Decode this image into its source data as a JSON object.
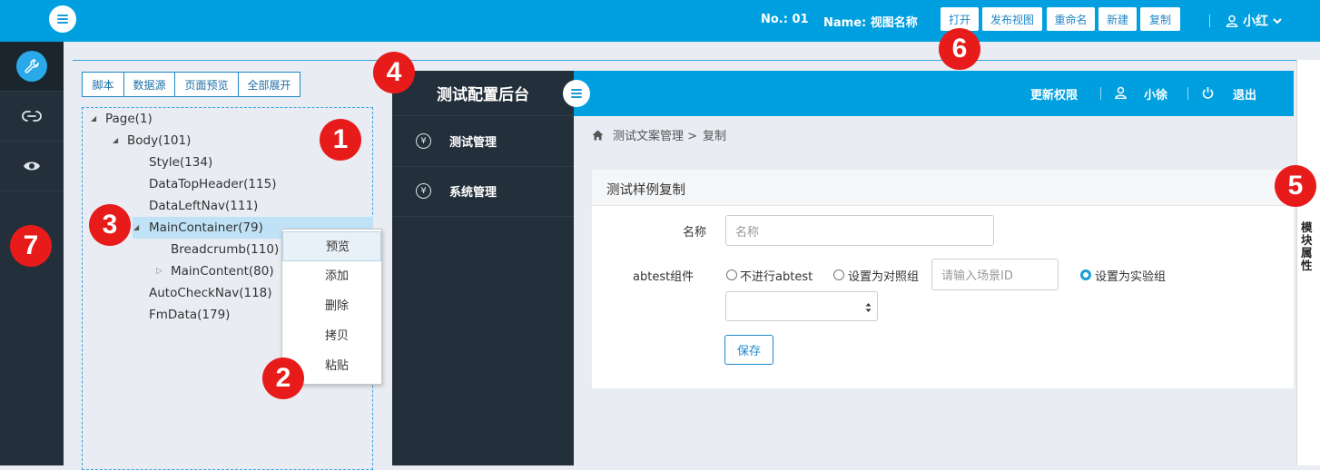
{
  "topbar": {
    "no_label": "No.: 01",
    "name_label": "Name: 视图名称",
    "buttons": [
      "打开",
      "发布视图",
      "重命名",
      "新建",
      "复制"
    ],
    "user": "小红"
  },
  "toolbar": {
    "buttons": [
      "脚本",
      "数据源",
      "页面预览",
      "全部展开"
    ]
  },
  "tree": {
    "nodes": [
      "Page(1)",
      "Body(101)",
      "Style(134)",
      "DataTopHeader(115)",
      "DataLeftNav(111)",
      "MainContainer(79)",
      "Breadcrumb(110)",
      "MainContent(80)",
      "AutoCheckNav(118)",
      "FmData(179)"
    ]
  },
  "context_menu": {
    "items": [
      "预览",
      "添加",
      "删除",
      "拷贝",
      "粘贴"
    ]
  },
  "badges": [
    "1",
    "2",
    "3",
    "4",
    "5",
    "6",
    "7"
  ],
  "preview": {
    "brand": "测试配置后台",
    "header": {
      "update_perm": "更新权限",
      "user": "小徐",
      "logout": "退出"
    },
    "nav": [
      "测试管理",
      "系统管理"
    ],
    "nav_icon_glyph": "¥",
    "breadcrumb": {
      "path": "测试文案管理 >",
      "current": "复制"
    },
    "form": {
      "title": "测试样例复制",
      "name_label": "名称",
      "name_placeholder": "名称",
      "abtest_label": "abtest组件",
      "radio_no": "不进行abtest",
      "radio_control": "设置为对照组",
      "scene_placeholder": "请输入场景ID",
      "radio_exp": "设置为实验组",
      "save": "保存"
    }
  },
  "right_panel_label": "模块属性",
  "colors": {
    "primary": "#00a0e0",
    "dark": "#232f3a",
    "badge": "#e81b1b"
  }
}
